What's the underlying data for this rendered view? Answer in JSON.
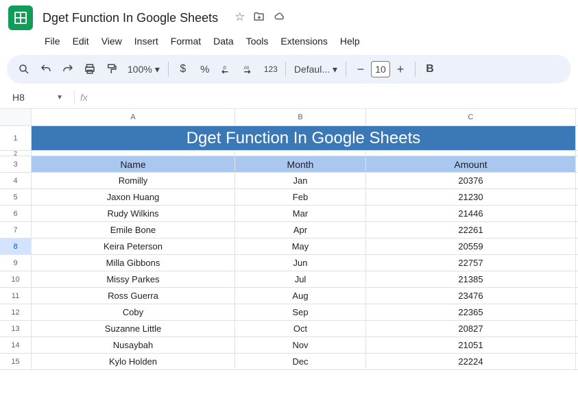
{
  "doc": {
    "title": "Dget Function In Google Sheets"
  },
  "menubar": [
    "File",
    "Edit",
    "View",
    "Insert",
    "Format",
    "Data",
    "Tools",
    "Extensions",
    "Help"
  ],
  "toolbar": {
    "zoom": "100%",
    "font": "Defaul...",
    "fontsize": "10",
    "bold": "B"
  },
  "namebox": "H8",
  "columns": [
    "A",
    "B",
    "C"
  ],
  "banner": "Dget Function In Google Sheets",
  "headers": {
    "name": "Name",
    "month": "Month",
    "amount": "Amount"
  },
  "selected_row": 8,
  "chart_data": {
    "type": "table",
    "title": "Dget Function In Google Sheets",
    "columns": [
      "Name",
      "Month",
      "Amount"
    ],
    "rows": [
      {
        "rownum": 4,
        "name": "Romilly",
        "month": "Jan",
        "amount": "20376"
      },
      {
        "rownum": 5,
        "name": "Jaxon Huang",
        "month": "Feb",
        "amount": "21230"
      },
      {
        "rownum": 6,
        "name": "Rudy Wilkins",
        "month": "Mar",
        "amount": "21446"
      },
      {
        "rownum": 7,
        "name": "Emile Bone",
        "month": "Apr",
        "amount": "22261"
      },
      {
        "rownum": 8,
        "name": "Keira Peterson",
        "month": "May",
        "amount": "20559"
      },
      {
        "rownum": 9,
        "name": "Milla Gibbons",
        "month": "Jun",
        "amount": "22757"
      },
      {
        "rownum": 10,
        "name": "Missy Parkes",
        "month": "Jul",
        "amount": "21385"
      },
      {
        "rownum": 11,
        "name": "Ross Guerra",
        "month": "Aug",
        "amount": "23476"
      },
      {
        "rownum": 12,
        "name": "Coby",
        "month": "Sep",
        "amount": "22365"
      },
      {
        "rownum": 13,
        "name": "Suzanne Little",
        "month": "Oct",
        "amount": "20827"
      },
      {
        "rownum": 14,
        "name": "Nusaybah",
        "month": "Nov",
        "amount": "21051"
      },
      {
        "rownum": 15,
        "name": "Kylo Holden",
        "month": "Dec",
        "amount": "22224"
      }
    ]
  }
}
